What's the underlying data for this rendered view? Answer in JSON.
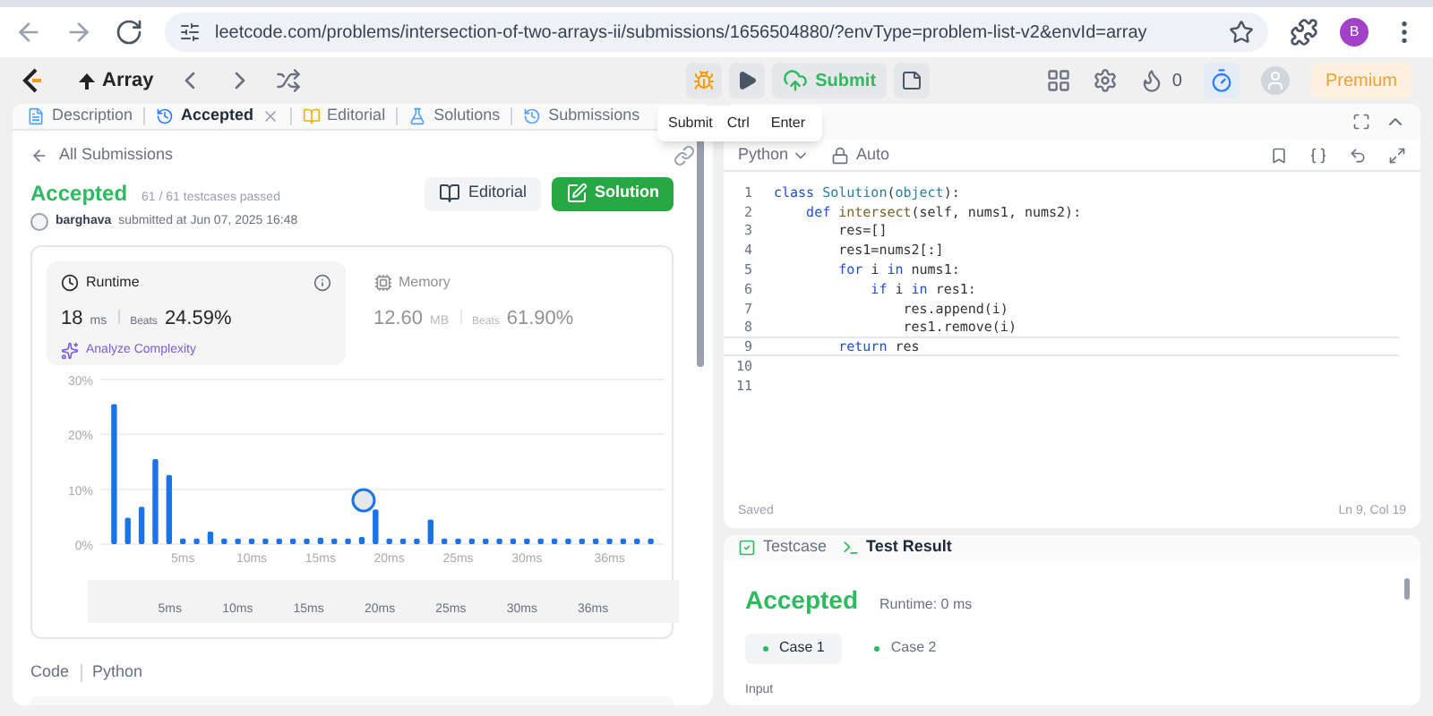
{
  "browser": {
    "url": "leetcode.com/problems/intersection-of-two-arrays-ii/submissions/1656504880/?envType=problem-list-v2&envId=array",
    "profile": "B"
  },
  "header": {
    "problem_list": "Array",
    "submit": "Submit",
    "streak": "0",
    "premium": "Premium"
  },
  "tooltip": {
    "label": "Submit",
    "keys": [
      "Ctrl",
      "Enter"
    ]
  },
  "left_tabs": [
    {
      "label": "Description",
      "selected": false,
      "closable": false
    },
    {
      "label": "Accepted",
      "selected": true,
      "closable": true
    },
    {
      "label": "Editorial",
      "selected": false,
      "closable": false
    },
    {
      "label": "Solutions",
      "selected": false,
      "closable": false
    },
    {
      "label": "Submissions",
      "selected": false,
      "closable": false
    }
  ],
  "back_link": "All Submissions",
  "submission": {
    "status": "Accepted",
    "passed": "61 / 61 testcases passed",
    "user": "barghava",
    "submitted": "submitted at Jun 07, 2025 16:48",
    "editorial_button": "Editorial",
    "solution_button": "Solution"
  },
  "stats": [
    {
      "title": "Runtime",
      "value": "18",
      "unit": "ms",
      "beats_label": "Beats",
      "beats": "24.59%",
      "selected": true,
      "link": "Analyze Complexity"
    },
    {
      "title": "Memory",
      "value": "12.60",
      "unit": "MB",
      "beats_label": "Beats",
      "beats": "61.90%",
      "selected": false
    }
  ],
  "chart_data": {
    "type": "bar",
    "x": [
      0,
      1,
      2,
      3,
      4,
      5,
      6,
      7,
      8,
      9,
      10,
      11,
      12,
      13,
      14,
      15,
      16,
      17,
      18,
      19,
      20,
      21,
      22,
      23,
      24,
      25,
      26,
      27,
      28,
      29,
      30,
      31,
      32,
      33,
      34,
      35,
      36,
      37,
      38,
      39
    ],
    "series": [
      {
        "color": "#1a73e8",
        "values": [
          25.5,
          4.8,
          6.8,
          15.5,
          12.6,
          1,
          1,
          2.3,
          1,
          1,
          1,
          1,
          1,
          1,
          1,
          1.2,
          1,
          1,
          1.3,
          6.3,
          1,
          1,
          1,
          4.5,
          1,
          1,
          1,
          1,
          1,
          1,
          1,
          1,
          1,
          1,
          1,
          1,
          1,
          1,
          1,
          1
        ]
      }
    ],
    "xlim": [
      -1,
      40
    ],
    "ylim": [
      0,
      30
    ],
    "yticks": [
      {
        "value": 0,
        "label": "0%"
      },
      {
        "value": 10,
        "label": "10%"
      },
      {
        "value": 20,
        "label": "20%"
      },
      {
        "value": 30,
        "label": "30%"
      }
    ],
    "xticks": [
      {
        "value": 5,
        "label": "5ms"
      },
      {
        "value": 10,
        "label": "10ms"
      },
      {
        "value": 15,
        "label": "15ms"
      },
      {
        "value": 20,
        "label": "20ms"
      },
      {
        "value": 25,
        "label": "25ms"
      },
      {
        "value": 30,
        "label": "30ms"
      },
      {
        "value": 36,
        "label": "36ms"
      }
    ]
  },
  "overview_labels": [
    "5ms",
    "10ms",
    "15ms",
    "20ms",
    "25ms",
    "30ms",
    "36ms"
  ],
  "code_section": {
    "label": "Code",
    "language": "Python"
  },
  "editor": {
    "language": "Python",
    "mode": "Auto",
    "status": "Saved",
    "cursor": "Ln 9, Col 19",
    "lines": [
      {
        "number": "1",
        "current": false,
        "tokens": [
          {
            "text": "class ",
            "kind": "kw"
          },
          {
            "text": "Solution",
            "kind": "type"
          },
          {
            "text": "(",
            "kind": "plain"
          },
          {
            "text": "object",
            "kind": "type"
          },
          {
            "text": "):",
            "kind": "plain"
          }
        ]
      },
      {
        "number": "2",
        "current": false,
        "tokens": [
          {
            "text": "    def ",
            "kind": "kw"
          },
          {
            "text": "intersect",
            "kind": "fn"
          },
          {
            "text": "(self, nums1, nums2):",
            "kind": "plain"
          }
        ]
      },
      {
        "number": "3",
        "current": false,
        "tokens": [
          {
            "text": "        res=[]",
            "kind": "plain"
          }
        ]
      },
      {
        "number": "4",
        "current": false,
        "tokens": [
          {
            "text": "        res1=nums2[:]",
            "kind": "plain"
          }
        ]
      },
      {
        "number": "5",
        "current": false,
        "tokens": [
          {
            "text": "        for ",
            "kind": "kw"
          },
          {
            "text": "i ",
            "kind": "plain"
          },
          {
            "text": "in ",
            "kind": "kw"
          },
          {
            "text": "nums1:",
            "kind": "plain"
          }
        ]
      },
      {
        "number": "6",
        "current": false,
        "tokens": [
          {
            "text": "            if ",
            "kind": "kw"
          },
          {
            "text": "i ",
            "kind": "plain"
          },
          {
            "text": "in ",
            "kind": "kw"
          },
          {
            "text": "res1:",
            "kind": "plain"
          }
        ]
      },
      {
        "number": "7",
        "current": false,
        "tokens": [
          {
            "text": "                res.append(i)",
            "kind": "plain"
          }
        ]
      },
      {
        "number": "8",
        "current": false,
        "tokens": [
          {
            "text": "                res1.remove(i)",
            "kind": "plain"
          }
        ]
      },
      {
        "number": "9",
        "current": true,
        "tokens": [
          {
            "text": "        return ",
            "kind": "kw"
          },
          {
            "text": "res",
            "kind": "plain"
          }
        ]
      },
      {
        "number": "10",
        "current": false
      },
      {
        "number": "11",
        "current": false
      }
    ]
  },
  "result_tabs": [
    {
      "label": "Testcase",
      "selected": false
    },
    {
      "label": "Test Result",
      "selected": true
    }
  ],
  "result": {
    "status": "Accepted",
    "runtime": "Runtime: 0 ms",
    "cases": [
      {
        "label": "Case 1",
        "selected": true
      },
      {
        "label": "Case 2",
        "selected": false
      }
    ],
    "input_label": "Input"
  }
}
